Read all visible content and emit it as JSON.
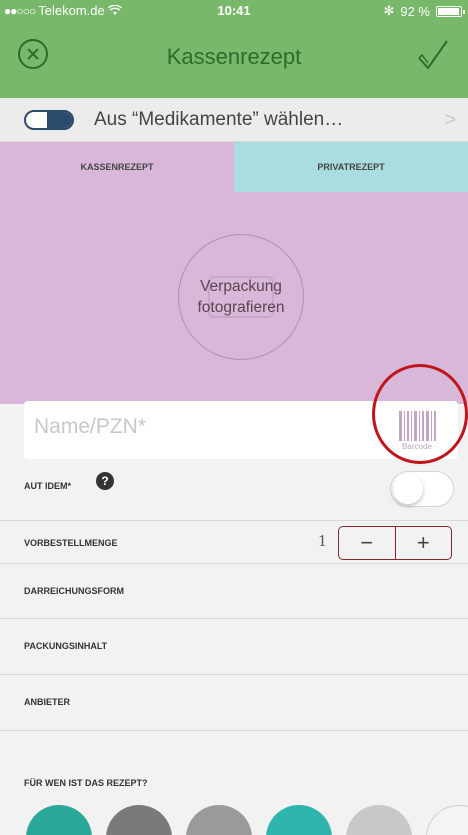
{
  "status_bar": {
    "carrier": "Telekom.de",
    "time": "10:41",
    "battery": "92 %"
  },
  "nav": {
    "title": "Kassenrezept",
    "close_icon": "close-circle-icon",
    "confirm_icon": "checkmark-icon"
  },
  "medication_picker": {
    "label": "Aus “Medikamente” wählen…",
    "icon": "pill-icon"
  },
  "tabs": [
    {
      "label": "KASSENREZEPT",
      "color": "#d9b7d9",
      "selected": true
    },
    {
      "label": "PRIVATREZEPT",
      "color": "#a9dde0",
      "selected": false
    }
  ],
  "photo": {
    "label_line1": "Verpackung",
    "label_line2": "fotografieren"
  },
  "name_field": {
    "placeholder": "Name/PZN*",
    "barcode_label": "Barcode"
  },
  "aut_idem": {
    "label": "AUT IDEM*",
    "help": "?",
    "toggle_on": false
  },
  "vorbestellmenge": {
    "label": "VORBESTELLMENGE",
    "value": "1",
    "minus": "−",
    "plus": "+"
  },
  "rows": [
    {
      "label": "DARREICHUNGSFORM"
    },
    {
      "label": "PACKUNGSINHALT"
    },
    {
      "label": "ANBIETER"
    }
  ],
  "recipients": {
    "title": "FÜR WEN IST DAS REZEPT?",
    "avatar_colors": [
      "#2aa89a",
      "#7a7a7a",
      "#9a9a9a",
      "#2fb5ad",
      "#c8c8c8",
      "#e8e8e8"
    ]
  },
  "colors": {
    "nav_green": "#78b86a",
    "kasse_pink": "#d9b7d9",
    "privat_blue": "#a9dde0",
    "highlight_ring": "#c0151c"
  }
}
